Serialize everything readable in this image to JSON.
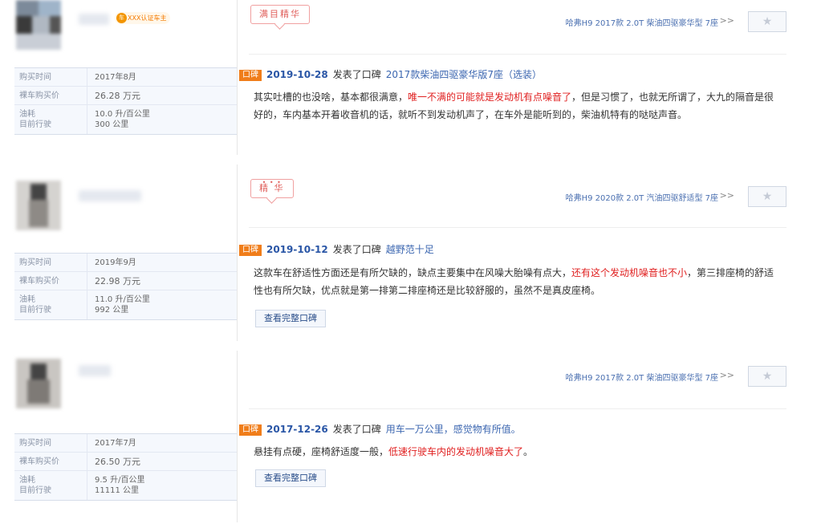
{
  "reviews": [
    {
      "badge": "XXX认证车主",
      "tag": "满目精华",
      "tag_dots": "",
      "car_model": "哈弗H9 2017款 2.0T 柴油四驱豪华型 7座",
      "chevron": ">>",
      "star": "★",
      "info": [
        {
          "label": "购买时间",
          "value": "2017年8月"
        },
        {
          "label": "裸车购买价",
          "value": "26.28 万元"
        },
        {
          "label": "油耗\n目前行驶",
          "value": "10.0 升/百公里\n300 公里"
        }
      ],
      "kb": "口碑",
      "date": "2019-10-28",
      "posted": "发表了口碑",
      "title": "2017款柴油四驱豪华版7座（选装）",
      "body": [
        {
          "text": "其实吐槽的也没啥，基本都很满意，",
          "hl": false
        },
        {
          "text": "唯一不满的可能就是发动机有点噪音了",
          "hl": true
        },
        {
          "text": "，但是习惯了，也就无所谓了，大九的隔音是很好的，车内基本开着收音机的话，就听不到发动机声了，在车外是能听到的，柴油机特有的哒哒声音。",
          "hl": false
        }
      ],
      "full_btn": ""
    },
    {
      "badge": "",
      "tag": "精 华",
      "tag_dots": "• • •",
      "car_model": "哈弗H9 2020款 2.0T 汽油四驱舒适型 7座",
      "chevron": ">>",
      "star": "★",
      "info": [
        {
          "label": "购买时间",
          "value": "2019年9月"
        },
        {
          "label": "裸车购买价",
          "value": "22.98 万元"
        },
        {
          "label": "油耗\n目前行驶",
          "value": "11.0 升/百公里\n992 公里"
        }
      ],
      "kb": "口碑",
      "date": "2019-10-12",
      "posted": "发表了口碑",
      "title": "越野范十足",
      "body": [
        {
          "text": "这款车在舒适性方面还是有所欠缺的，缺点主要集中在风噪大胎噪有点大，",
          "hl": false
        },
        {
          "text": "还有这个发动机噪音也不小",
          "hl": true
        },
        {
          "text": "，第三排座椅的舒适性也有所欠缺，优点就是第一排第二排座椅还是比较舒服的，虽然不是真皮座椅。",
          "hl": false
        }
      ],
      "full_btn": "查看完整口碑"
    },
    {
      "badge": "",
      "tag": "",
      "tag_dots": "",
      "car_model": "哈弗H9 2017款 2.0T 柴油四驱豪华型 7座",
      "chevron": ">>",
      "star": "★",
      "info": [
        {
          "label": "购买时间",
          "value": "2017年7月"
        },
        {
          "label": "裸车购买价",
          "value": "26.50 万元"
        },
        {
          "label": "油耗\n目前行驶",
          "value": "9.5 升/百公里\n11111 公里"
        }
      ],
      "kb": "口碑",
      "date": "2017-12-26",
      "posted": "发表了口碑",
      "title": "用车一万公里，感觉物有所值。",
      "body": [
        {
          "text": "悬挂有点硬，座椅舒适度一般，",
          "hl": false
        },
        {
          "text": "低速行驶车内的发动机噪音大了",
          "hl": true
        },
        {
          "text": "。",
          "hl": false
        }
      ],
      "full_btn": "查看完整口碑"
    }
  ]
}
